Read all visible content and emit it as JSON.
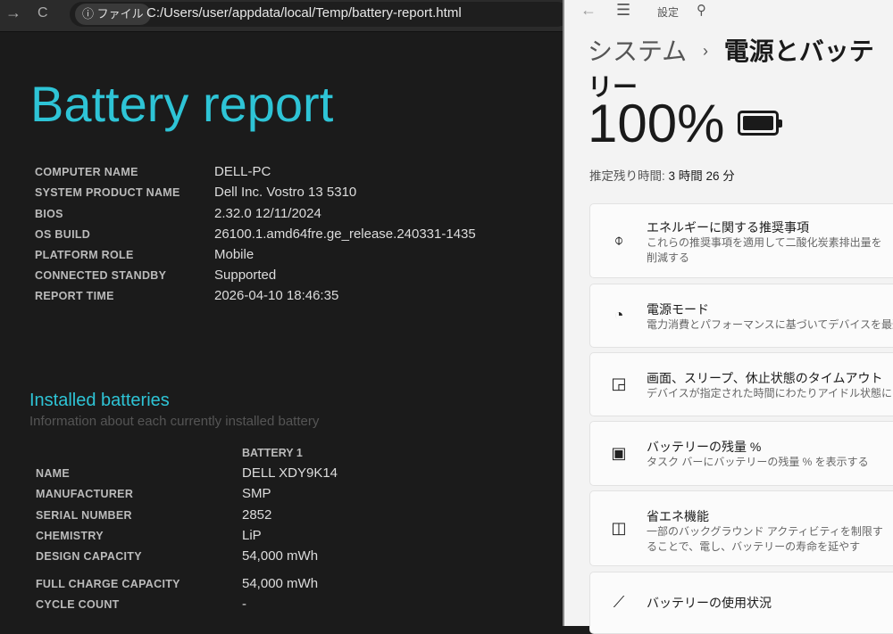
{
  "browser": {
    "back": "→",
    "reload": "C",
    "chip": "ⓘ ファイル",
    "url": "C:/Users/user/appdata/local/Temp/battery-report.html"
  },
  "report": {
    "title": "Battery report",
    "system": [
      {
        "label": "COMPUTER NAME",
        "value": "DELL-PC"
      },
      {
        "label": "SYSTEM PRODUCT NAME",
        "value": "Dell Inc. Vostro 13 5310"
      },
      {
        "label": "BIOS",
        "value": "2.32.0 12/11/2024"
      },
      {
        "label": "OS BUILD",
        "value": "26100.1.amd64fre.ge_release.240331-1435"
      },
      {
        "label": "PLATFORM ROLE",
        "value": "Mobile"
      },
      {
        "label": "CONNECTED STANDBY",
        "value": "Supported"
      },
      {
        "label": "REPORT TIME",
        "value": "2026-04-10  18:46:35"
      }
    ],
    "installed_title": "Installed batteries",
    "installed_sub": "Information about each currently installed battery",
    "battery_header": "BATTERY 1",
    "battery": [
      {
        "label": "NAME",
        "value": "DELL XDY9K14"
      },
      {
        "label": "MANUFACTURER",
        "value": "SMP"
      },
      {
        "label": "SERIAL NUMBER",
        "value": "2852"
      },
      {
        "label": "CHEMISTRY",
        "value": "LiP"
      },
      {
        "label": "DESIGN CAPACITY",
        "value": "54,000 mWh"
      },
      {
        "label": "FULL CHARGE CAPACITY",
        "value": "54,000 mWh"
      },
      {
        "label": "CYCLE COUNT",
        "value": "-"
      }
    ]
  },
  "settings": {
    "app": "設定",
    "crumb_parent": "システム",
    "crumb_sep": "›",
    "crumb_current": "電源とバッテリー",
    "percent": "100%",
    "remaining_label": "推定残り時間:",
    "remaining_value": "3 時間 26 分",
    "cards": [
      {
        "title": "エネルギーに関する推奨事項",
        "desc": "これらの推奨事項を適用して二酸化炭素排出量を削減する"
      },
      {
        "title": "電源モード",
        "desc": "電力消費とパフォーマンスに基づいてデバイスを最適化"
      },
      {
        "title": "画面、スリープ、休止状態のタイムアウト",
        "desc": "デバイスが指定された時間にわたりアイドル状態になった場"
      },
      {
        "title": "バッテリーの残量 %",
        "desc": "タスク バーにバッテリーの残量 % を表示する"
      },
      {
        "title": "省エネ機能",
        "desc": "一部のバックグラウンド アクティビティを制限することで、電し、バッテリーの寿命を延やす"
      },
      {
        "title": "バッテリーの使用状況"
      }
    ]
  }
}
